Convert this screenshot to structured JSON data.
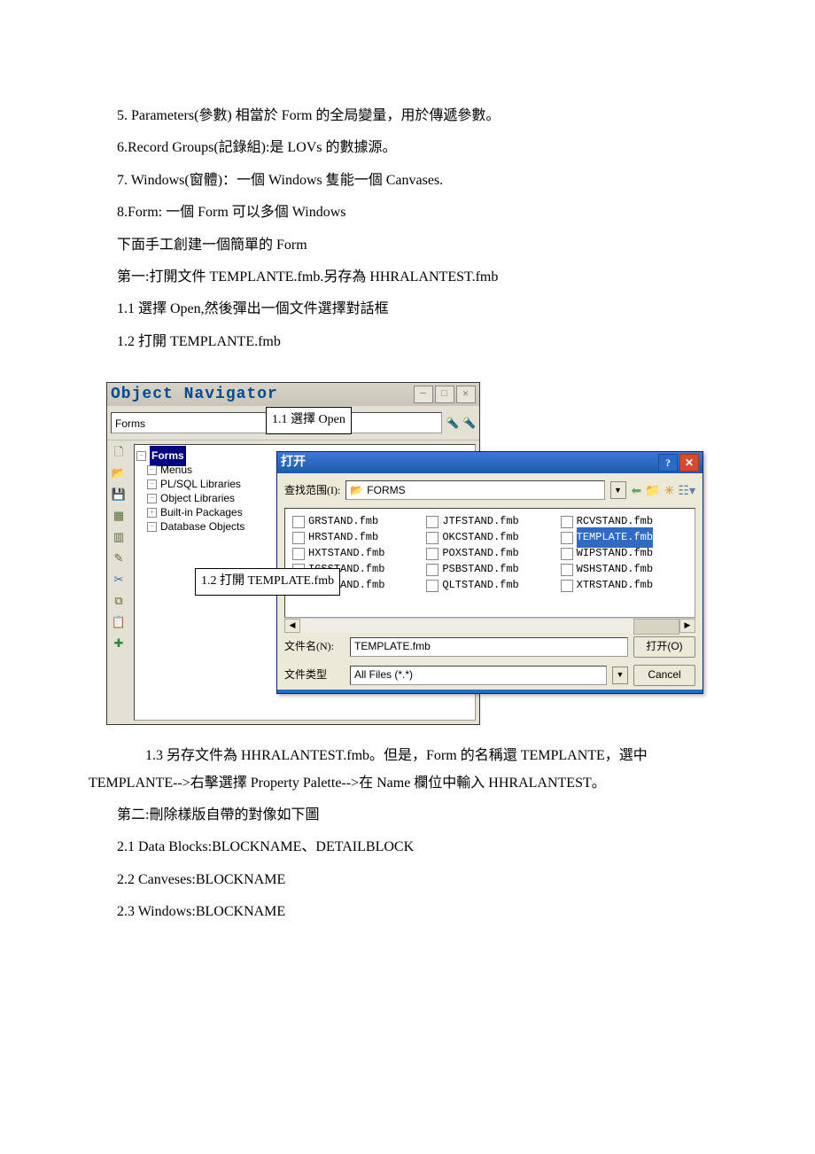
{
  "doc": {
    "p1": "5. Parameters(參數) 相當於 Form 的全局變量，用於傳遞參數。",
    "p2": "6.Record Groups(記錄組):是 LOVs 的數據源。",
    "p3": "7. Windows(窗體)：一個 Windows 隻能一個 Canvases.",
    "p4": "8.Form: 一個 Form 可以多個 Windows",
    "p5": "下面手工創建一個簡單的 Form",
    "p6": "第一:打開文件 TEMPLANTE.fmb.另存為 HHRALANTEST.fmb",
    "p7": "1.1 選擇 Open,然後彈出一個文件選擇對話框",
    "p8": "1.2 打開 TEMPLANTE.fmb",
    "p9": "1.3 另存文件為 HHRALANTEST.fmb。但是，Form 的名稱還 TEMPLANTE，選中 TEMPLANTE-->右擊選擇 Property Palette-->在 Name 欄位中輸入 HHRALANTEST。",
    "p10": "第二:刪除樣版自帶的對像如下圖",
    "p11": "2.1 Data Blocks:BLOCKNAME、DETAILBLOCK",
    "p12": "2.2 Canveses:BLOCKNAME",
    "p13": "2.3 Windows:BLOCKNAME"
  },
  "nav": {
    "title": "Object Navigator",
    "search": "Forms",
    "tree": {
      "forms": "Forms",
      "menus": "Menus",
      "plsql": "PL/SQL Libraries",
      "objlib": "Object Libraries",
      "builtin": "Built-in Packages",
      "dbobj": "Database Objects"
    }
  },
  "callout": {
    "c1": "1.1 選擇 Open",
    "c2": "1.2 打開 TEMPLATE.fmb"
  },
  "dlg": {
    "title": "打开",
    "lookin_label": "查找范围(I):",
    "lookin_value": "FORMS",
    "filename_label": "文件名(N):",
    "filename_value": "TEMPLATE.fmb",
    "filetype_label": "文件类型",
    "filetype_value": "All Files (*.*)",
    "open_btn": "打开(O)",
    "cancel_btn": "Cancel",
    "files": [
      "GRSTAND.fmb",
      "JTFSTAND.fmb",
      "RCVSTAND.fmb",
      "HRSTAND.fmb",
      "OKCSTAND.fmb",
      "TEMPLATE.fmb",
      "HXTSTAND.fmb",
      "POXSTAND.fmb",
      "WIPSTAND.fmb",
      "IGSSTAND.fmb",
      "PSBSTAND.fmb",
      "WSHSTAND.fmb",
      "INVSTAND.fmb",
      "QLTSTAND.fmb",
      "XTRSTAND.fmb"
    ],
    "selected_file": "TEMPLATE.fmb"
  }
}
